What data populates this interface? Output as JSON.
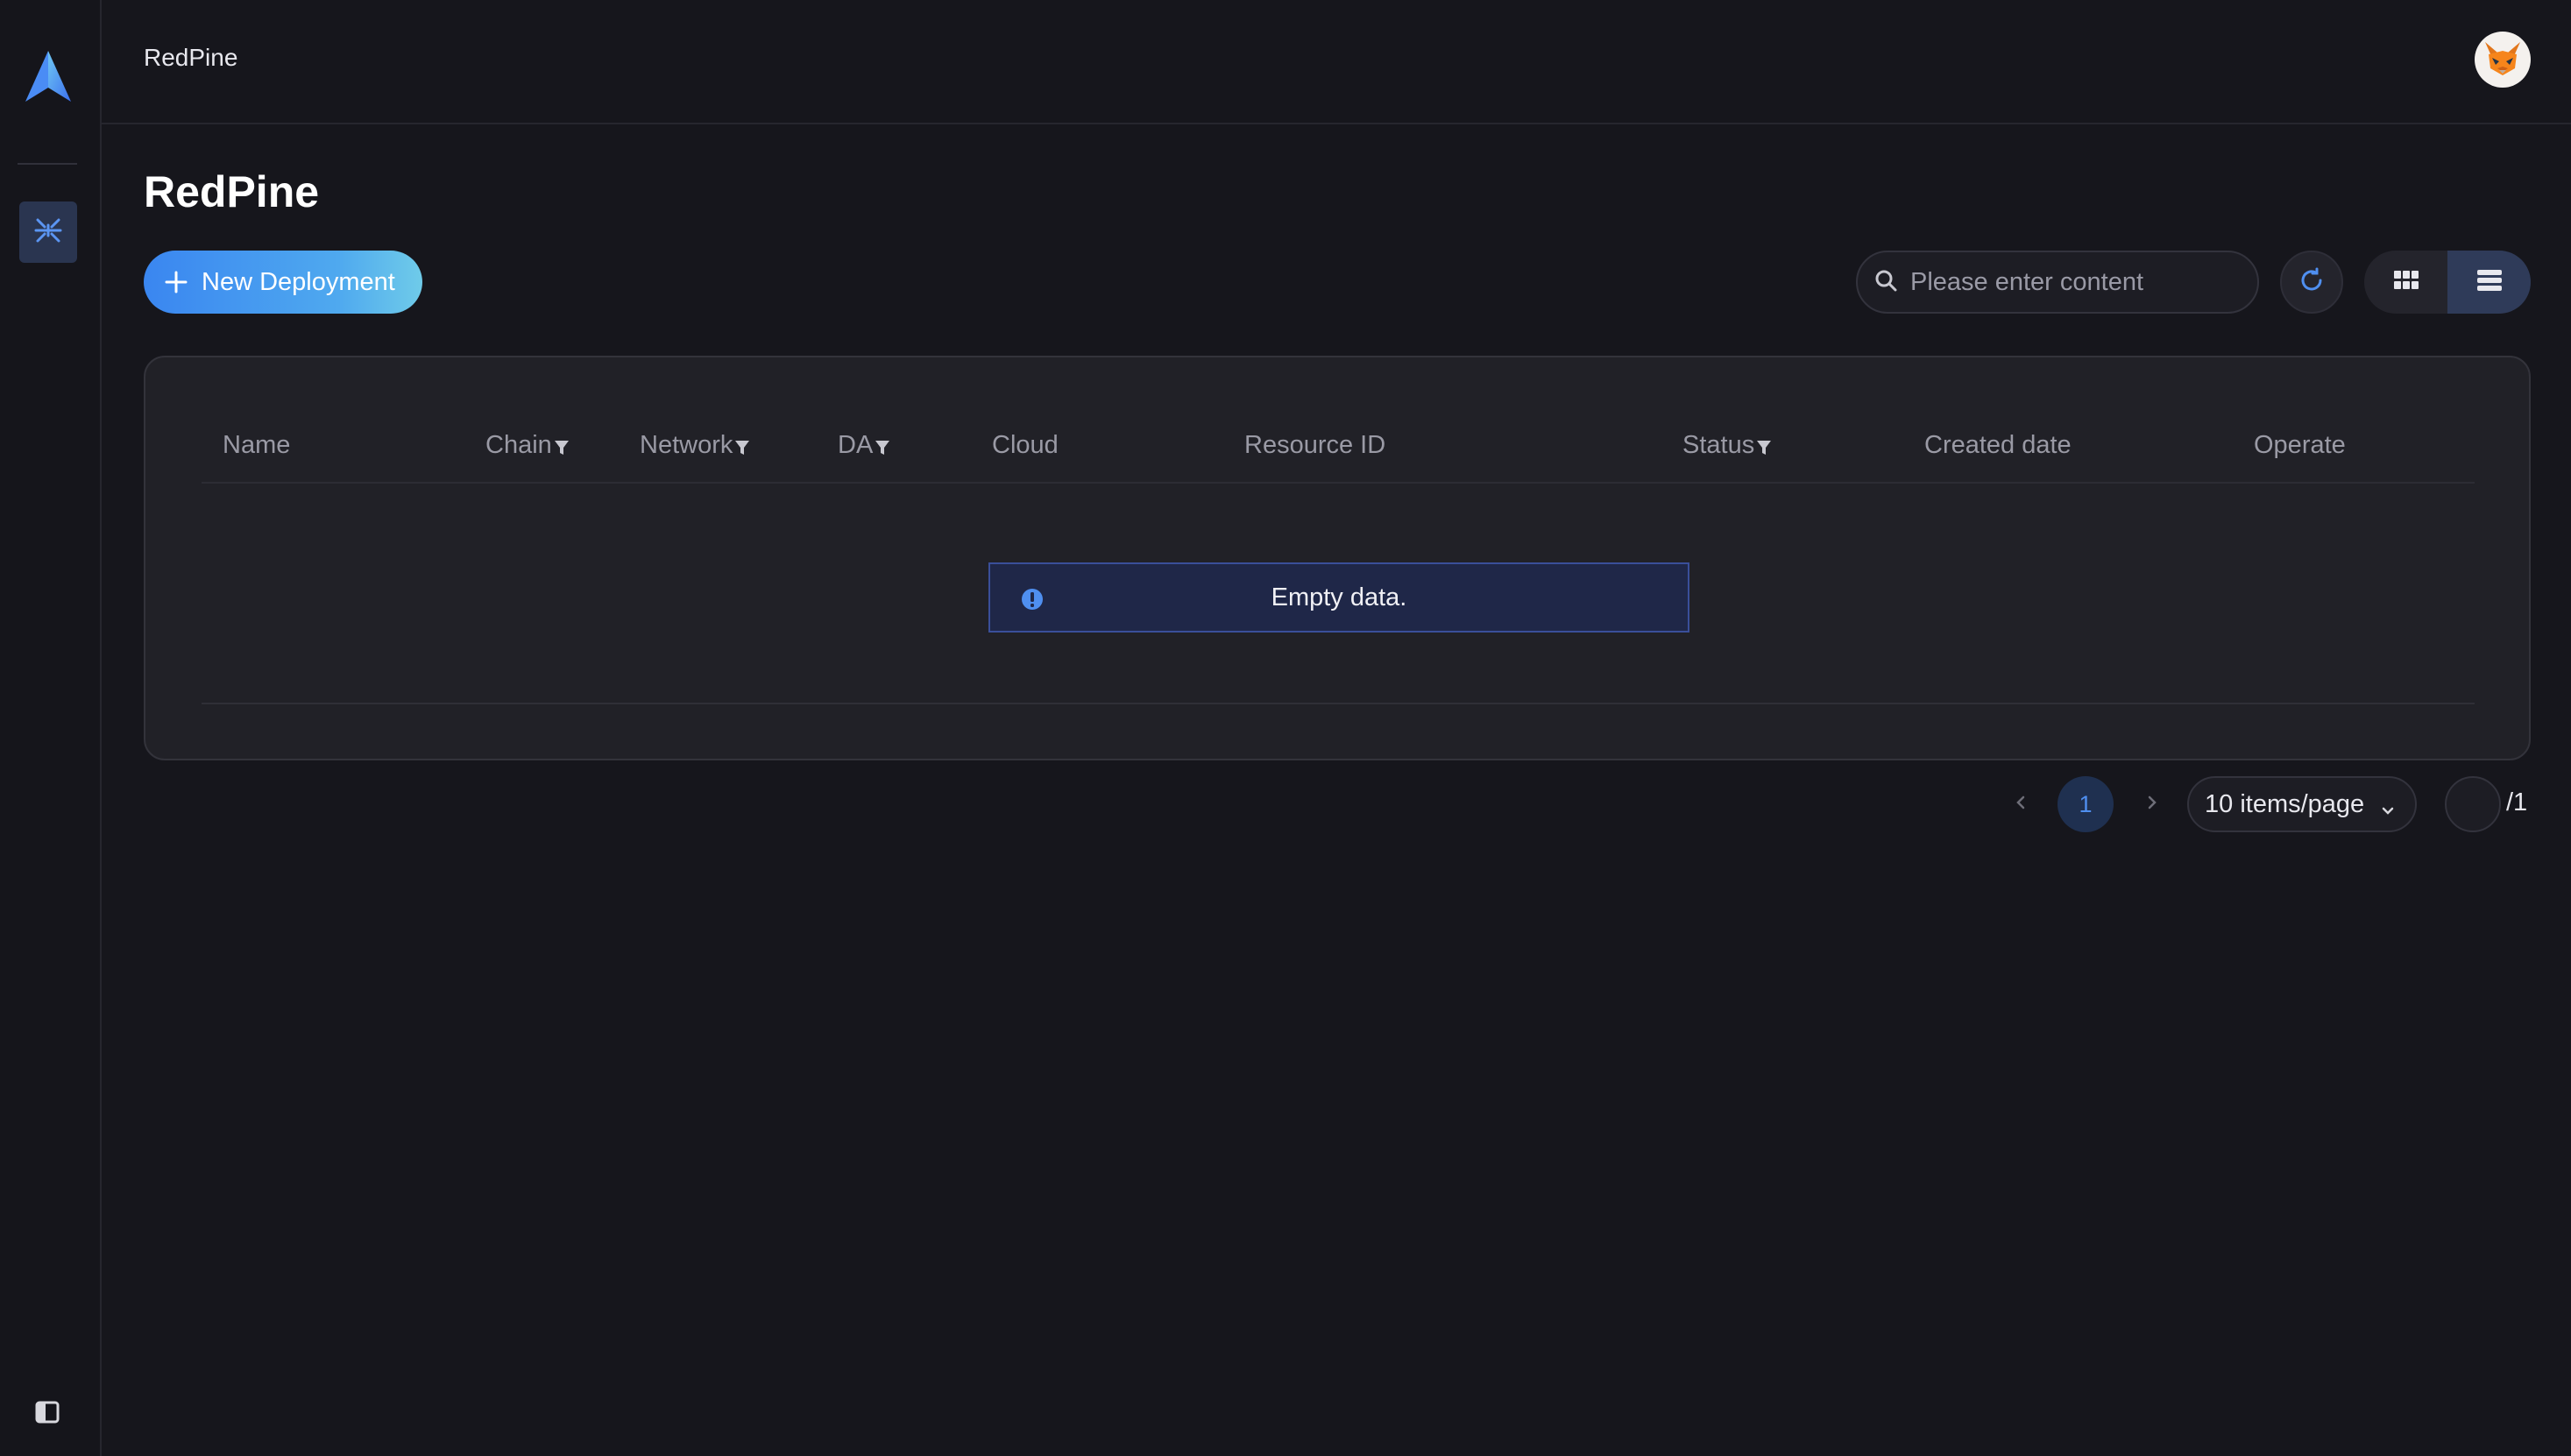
{
  "app": {
    "name": "RedPine"
  },
  "breadcrumb": {
    "current": "RedPine"
  },
  "page": {
    "title": "RedPine"
  },
  "toolbar": {
    "new_label": "New Deployment",
    "search_placeholder": "Please enter content",
    "search_value": ""
  },
  "table": {
    "columns": [
      {
        "label": "Name",
        "filterable": false
      },
      {
        "label": "Chain",
        "filterable": true
      },
      {
        "label": "Network",
        "filterable": true
      },
      {
        "label": "DA",
        "filterable": true
      },
      {
        "label": "Cloud",
        "filterable": false
      },
      {
        "label": "Resource ID",
        "filterable": false
      },
      {
        "label": "Status",
        "filterable": true
      },
      {
        "label": "Created date",
        "filterable": false
      },
      {
        "label": "Operate",
        "filterable": false
      }
    ],
    "rows": [],
    "empty_text": "Empty data."
  },
  "pagination": {
    "current_page": "1",
    "page_size_label": "10 items/page",
    "jump_value": "",
    "total_label": "/1"
  },
  "colors": {
    "background": "#16161c",
    "card": "#212127",
    "accent": "#3a86f0",
    "empty_bg": "#1f2748",
    "active_nav": "#2a3550"
  },
  "icons": {
    "logo": "logo-icon",
    "nav": "deployment-icon",
    "collapse": "sidebar-collapse-icon",
    "avatar": "fox-avatar",
    "plus": "plus-icon",
    "search": "search-icon",
    "refresh": "refresh-icon",
    "grid": "grid-view-icon",
    "list": "list-view-icon",
    "filter": "filter-icon",
    "info": "info-icon",
    "prev": "chevron-left-icon",
    "next": "chevron-right-icon",
    "dropdown": "chevron-down-icon"
  }
}
